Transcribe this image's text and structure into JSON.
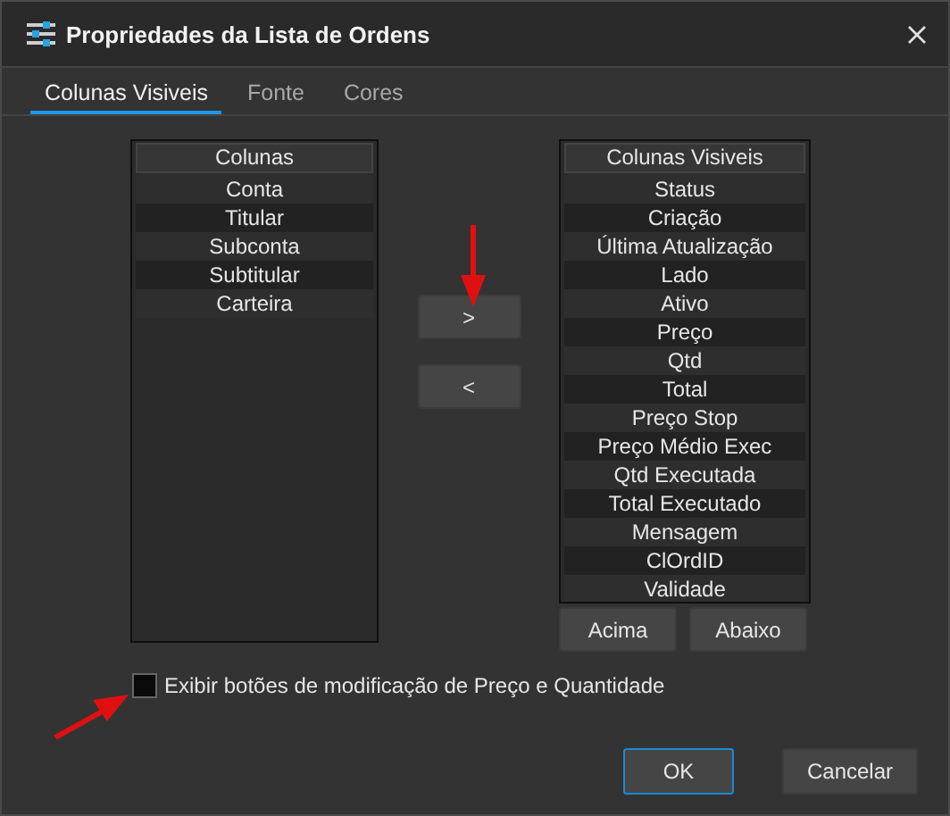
{
  "window": {
    "title": "Propriedades da Lista de Ordens"
  },
  "tabs": [
    {
      "label": "Colunas Visiveis",
      "selected": true
    },
    {
      "label": "Fonte",
      "selected": false
    },
    {
      "label": "Cores",
      "selected": false
    }
  ],
  "available_list": {
    "header": "Colunas",
    "items": [
      "Conta",
      "Titular",
      "Subconta",
      "Subtitular",
      "Carteira"
    ]
  },
  "move_buttons": [
    ">",
    "<"
  ],
  "visible_list": {
    "header": "Colunas Visiveis",
    "items": [
      "Status",
      "Criação",
      "Última Atualização",
      "Lado",
      "Ativo",
      "Preço",
      "Qtd",
      "Total",
      "Preço Stop",
      "Preço Médio Exec",
      "Qtd Executada",
      "Total Executado",
      "Mensagem",
      "ClOrdID",
      "Validade"
    ]
  },
  "order_buttons": [
    "Acima",
    "Abaixo"
  ],
  "option": {
    "label": "Exibir botões de modificação de Preço e Quantidade",
    "checked": false
  },
  "dialog_buttons": [
    {
      "label": "OK",
      "kind": "default"
    },
    {
      "label": "Cancelar",
      "kind": "normal"
    }
  ]
}
